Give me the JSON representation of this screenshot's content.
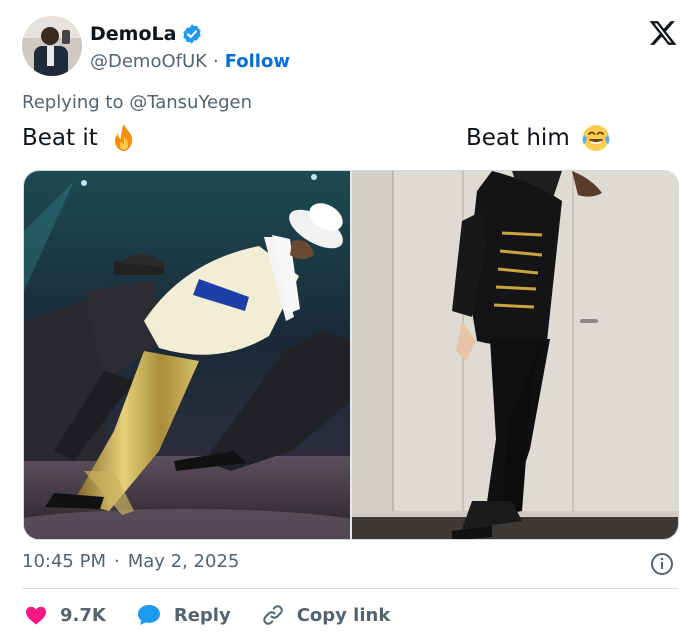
{
  "author": {
    "display_name": "DemoLa",
    "handle": "@DemoOfUK",
    "separator": "·",
    "follow_label": "Follow",
    "verified": true
  },
  "reply_context": {
    "prefix": "Replying to ",
    "mention": "@TansuYegen"
  },
  "captions": {
    "left": "Beat it",
    "left_emoji": "fire",
    "right": "Beat him",
    "right_emoji": "face-with-tears-of-joy"
  },
  "meta": {
    "time": "10:45 PM",
    "separator": "·",
    "date": "May 2, 2025"
  },
  "actions": {
    "likes_count": "9.7K",
    "reply_label": "Reply",
    "copy_link_label": "Copy link"
  },
  "colors": {
    "text": "#0f1419",
    "secondary": "#536471",
    "link": "#006fd6",
    "verified": "#1d9bf0",
    "like": "#f91880",
    "reply": "#1d9bf0",
    "border": "#cfd9de"
  },
  "icons": {
    "verified": "verified-badge-icon",
    "brand": "x-logo-icon",
    "info": "info-icon",
    "like": "heart-icon",
    "reply": "speech-bubble-icon",
    "copy_link": "link-icon"
  }
}
